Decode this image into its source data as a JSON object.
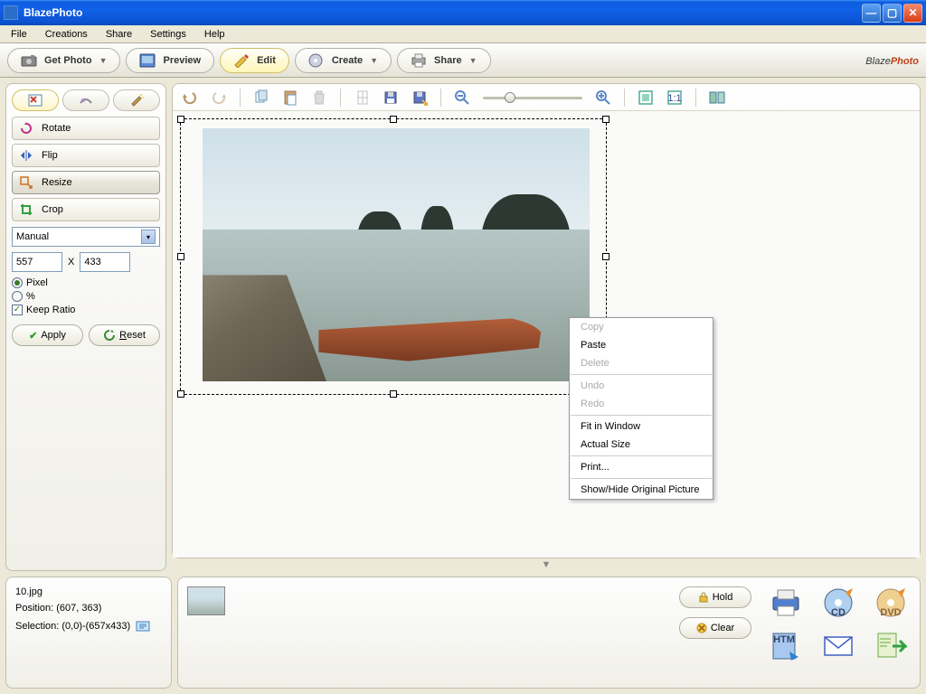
{
  "window": {
    "title": "BlazePhoto"
  },
  "menu": [
    "File",
    "Creations",
    "Share",
    "Settings",
    "Help"
  ],
  "toolbar": {
    "getphoto": "Get Photo",
    "preview": "Preview",
    "edit": "Edit",
    "create": "Create",
    "share": "Share"
  },
  "brand": {
    "a": "Blaze",
    "b": "Photo"
  },
  "sidebar": {
    "tools": [
      "Rotate",
      "Flip",
      "Resize",
      "Crop"
    ],
    "mode": "Manual",
    "width": "557",
    "height": "433",
    "xlabel": "X",
    "unit_pixel": "Pixel",
    "unit_percent": "%",
    "keep_ratio": "Keep Ratio",
    "apply": "Apply",
    "reset": "Reset"
  },
  "context_menu": {
    "copy": "Copy",
    "paste": "Paste",
    "delete": "Delete",
    "undo": "Undo",
    "redo": "Redo",
    "fit": "Fit in Window",
    "actual": "Actual Size",
    "print": "Print...",
    "showhide": "Show/Hide Original Picture"
  },
  "info": {
    "filename": "10.jpg",
    "position": "Position: (607, 363)",
    "selection": "Selection: (0,0)-(657x433)"
  },
  "actions": {
    "hold": "Hold",
    "clear": "Clear"
  }
}
